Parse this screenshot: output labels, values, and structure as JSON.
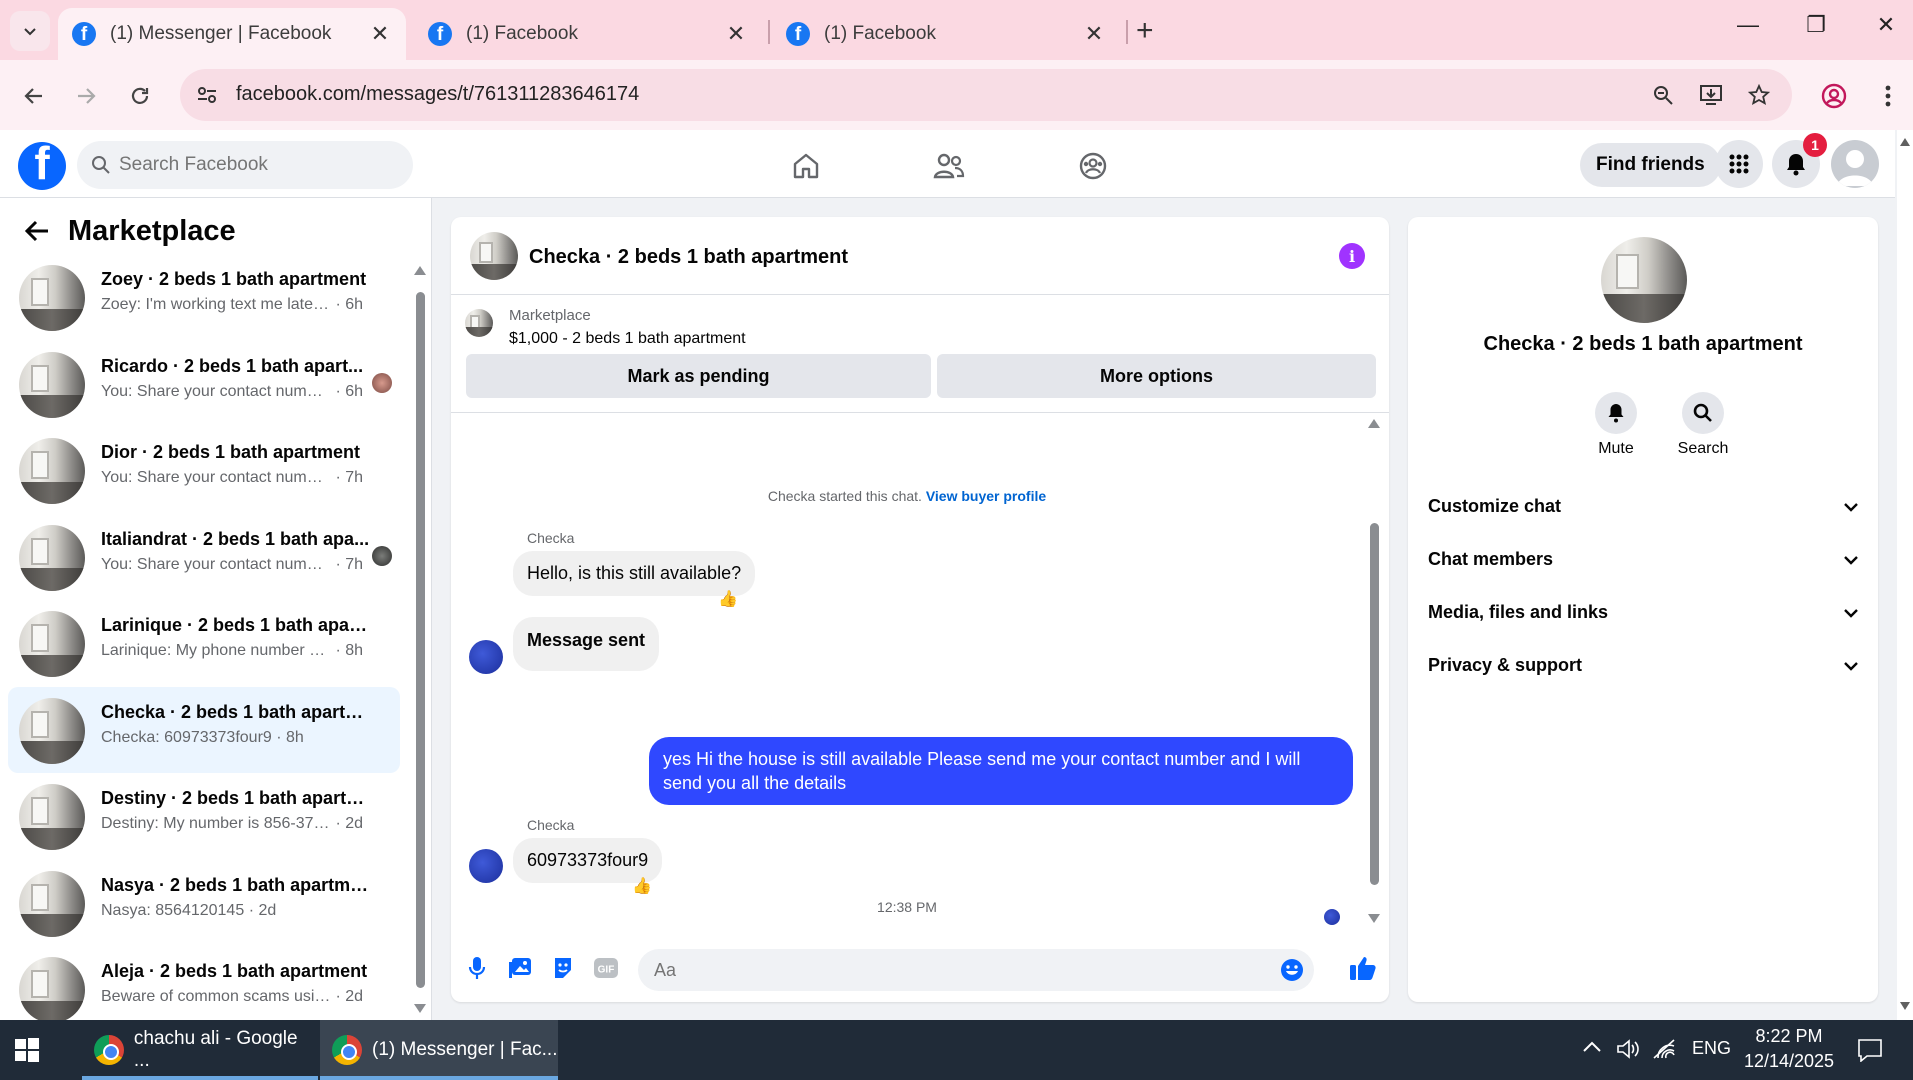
{
  "browser": {
    "tabs": [
      {
        "title": "(1) Messenger | Facebook",
        "active": true
      },
      {
        "title": "(1) Facebook",
        "active": false
      },
      {
        "title": "(1) Facebook",
        "active": false
      }
    ],
    "url": "facebook.com/messages/t/761311283646174"
  },
  "fb": {
    "search_placeholder": "Search Facebook",
    "find_friends": "Find friends",
    "notification_count": "1"
  },
  "left": {
    "title": "Marketplace",
    "conversations": [
      {
        "name": "Zoey · 2 beds 1 bath apartment",
        "preview": "Zoey: I'm working text me later 85...",
        "time": "· 6h"
      },
      {
        "name": "Ricardo · 2 beds 1 bath apart...",
        "preview": "You: Share your contact number...",
        "time": "· 6h"
      },
      {
        "name": "Dior · 2 beds 1 bath apartment",
        "preview": "You: Share your contact number a...",
        "time": "· 7h"
      },
      {
        "name": "Italiandrat · 2 beds 1 bath apa...",
        "preview": "You: Share your contact number...",
        "time": "· 7h"
      },
      {
        "name": "Larinique · 2 beds 1 bath apart...",
        "preview": "Larinique: My phone number 8567...",
        "time": "· 8h"
      },
      {
        "name": "Checka · 2 beds 1 bath apartment",
        "preview": "Checka: 60973373four9",
        "time": "· 8h"
      },
      {
        "name": "Destiny · 2 beds 1 bath apartment",
        "preview": "Destiny: My number is 856-378-32...",
        "time": "· 2d"
      },
      {
        "name": "Nasya · 2 beds 1 bath apartment",
        "preview": "Nasya: 8564120145",
        "time": "· 2d"
      },
      {
        "name": "Aleja · 2 beds 1 bath apartment",
        "preview": "Beware of common scams using p...",
        "time": "· 2d"
      }
    ]
  },
  "chat": {
    "title": "Checka · 2 beds 1 bath apartment",
    "marketplace_label": "Marketplace",
    "listing": "$1,000 - 2 beds 1 bath apartment",
    "mark_pending": "Mark as pending",
    "more_options": "More options",
    "started_text": "Checka started this chat.",
    "view_buyer_profile": "View buyer profile",
    "sender_1": "Checka",
    "msg_1": "Hello, is this still available?",
    "msg_2": "Message sent",
    "timestamp": "12:38 PM",
    "msg_3": "yes Hi the house is still available Please send me your contact number and I will send you all the details",
    "sender_2": "Checka",
    "msg_4": "60973373four9",
    "input_placeholder": "Aa"
  },
  "right": {
    "name": "Checka · 2 beds 1 bath apartment",
    "mute": "Mute",
    "search": "Search",
    "sections": [
      "Customize chat",
      "Chat members",
      "Media, files and links",
      "Privacy & support"
    ]
  },
  "taskbar": {
    "item_1": "chachu ali - Google ...",
    "item_2": "(1) Messenger | Fac...",
    "lang": "ENG",
    "time": "8:22 PM",
    "date": "12/14/2025"
  },
  "colors": {
    "fb_blue": "#0866ff",
    "outgoing_bubble": "#2f48ff",
    "tab_strip": "#fbd9e2",
    "info_purple": "#a033ff"
  }
}
